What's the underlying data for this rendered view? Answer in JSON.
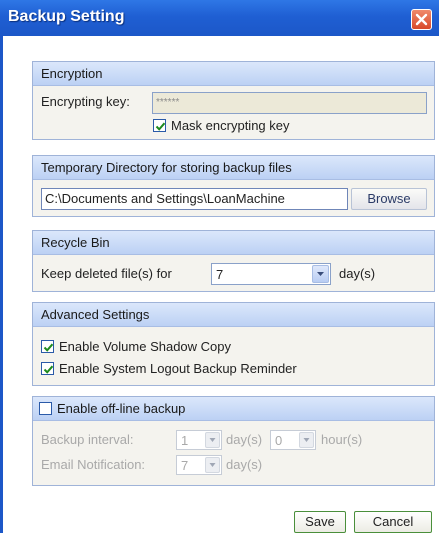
{
  "window": {
    "title": "Backup Setting",
    "close_icon": "close-x-icon"
  },
  "encryption": {
    "header": "Encryption",
    "key_label": "Encrypting key:",
    "key_value": "******",
    "mask_checkbox_label": "Mask encrypting key",
    "mask_checked": true
  },
  "temp_dir": {
    "header": "Temporary Directory for storing backup files",
    "path_value": "C:\\Documents and Settings\\LoanMachine",
    "browse_label": "Browse"
  },
  "recycle_bin": {
    "header": "Recycle Bin",
    "keep_label": "Keep deleted file(s) for",
    "keep_value": "7",
    "unit_label": "day(s)"
  },
  "advanced": {
    "header": "Advanced Settings",
    "shadow_copy_label": "Enable Volume Shadow Copy",
    "shadow_copy_checked": true,
    "logout_reminder_label": "Enable System Logout Backup Reminder",
    "logout_reminder_checked": true
  },
  "offline": {
    "header_checkbox_label": "Enable off-line backup",
    "enabled": false,
    "interval_label": "Backup interval:",
    "interval_days_value": "1",
    "days_unit": "day(s)",
    "interval_hours_value": "0",
    "hours_unit": "hour(s)",
    "email_label": "Email Notification:",
    "email_days_value": "7",
    "email_unit": "day(s)"
  },
  "footer": {
    "save_label": "Save",
    "cancel_label": "Cancel"
  },
  "colors": {
    "titlebar": "#1f5fd3",
    "panel_header": "#bcd1f4",
    "checkbox_check": "#1d8a1d",
    "disabled_text": "#a9a9a9"
  }
}
